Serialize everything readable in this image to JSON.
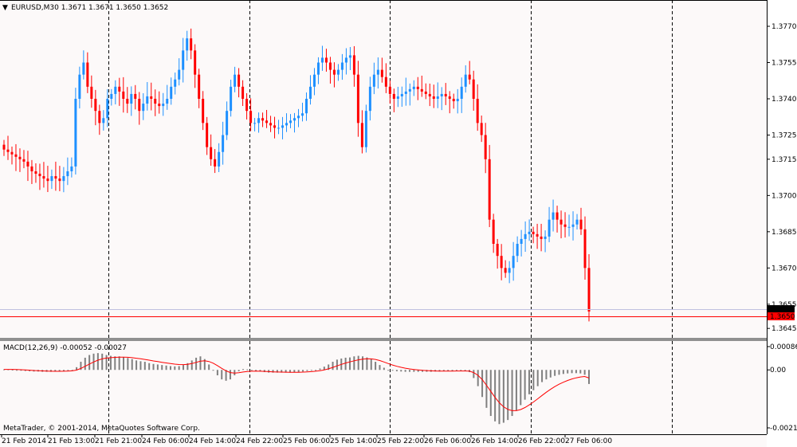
{
  "window": {
    "symbol_header": "EURUSD,M30  1.3671 1.3671 1.3650 1.3652",
    "header_arrow": "▼",
    "macd_header": "MACD(12,26,9) -0.00052 -0.00027",
    "copyright": "MetaTrader, © 2001-2014, MetaQuotes Software Corp.",
    "colors": {
      "background": "#fcf9f9",
      "bull": "#1e90ff",
      "bear": "#ff0000",
      "hist": "#808080",
      "signal": "#ff0000",
      "ask_line": "#c0c0e0",
      "bid_line": "#ff0000",
      "grid": "#000000"
    }
  },
  "price_axis": {
    "labels": [
      "1.3770",
      "1.3755",
      "1.3740",
      "1.3725",
      "1.3715",
      "1.3700",
      "1.3685",
      "1.3670",
      "1.3655",
      "1.3645"
    ],
    "current_ask": "1.3652",
    "current_bid": "1.3650"
  },
  "macd_axis": {
    "labels": [
      "0.00086",
      "0.00",
      "-0.00214"
    ]
  },
  "time_axis": {
    "labels": [
      "21 Feb 2014",
      "21 Feb 13:00",
      "21 Feb 21:00",
      "24 Feb 06:00",
      "24 Feb 14:00",
      "24 Feb 22:00",
      "25 Feb 06:00",
      "25 Feb 14:00",
      "25 Feb 22:00",
      "26 Feb 06:00",
      "26 Feb 14:00",
      "26 Feb 22:00",
      "27 Feb 06:00"
    ]
  },
  "chart_data": {
    "type": "line",
    "title": "EURUSD,M30",
    "price_series": [
      1.3719,
      1.3718,
      1.3717,
      1.3716,
      1.3715,
      1.3714,
      1.3712,
      1.371,
      1.3709,
      1.3708,
      1.3707,
      1.3706,
      1.3708,
      1.3707,
      1.3706,
      1.3708,
      1.371,
      1.3712,
      1.374,
      1.375,
      1.3755,
      1.3745,
      1.374,
      1.3735,
      1.373,
      1.3732,
      1.374,
      1.3742,
      1.3745,
      1.3743,
      1.374,
      1.3738,
      1.3742,
      1.374,
      1.3735,
      1.3738,
      1.3741,
      1.374,
      1.3738,
      1.3737,
      1.3738,
      1.374,
      1.3745,
      1.3748,
      1.3752,
      1.376,
      1.3765,
      1.376,
      1.375,
      1.374,
      1.373,
      1.372,
      1.3715,
      1.3712,
      1.3718,
      1.3725,
      1.3735,
      1.3745,
      1.375,
      1.3745,
      1.374,
      1.3735,
      1.373,
      1.373,
      1.3732,
      1.3731,
      1.373,
      1.3729,
      1.3728,
      1.3728,
      1.3729,
      1.373,
      1.3731,
      1.3732,
      1.3733,
      1.3734,
      1.374,
      1.3745,
      1.375,
      1.3755,
      1.3757,
      1.3755,
      1.3752,
      1.375,
      1.3752,
      1.3755,
      1.3757,
      1.3758,
      1.375,
      1.373,
      1.372,
      1.3735,
      1.3745,
      1.375,
      1.3752,
      1.3749,
      1.3745,
      1.3742,
      1.374,
      1.3741,
      1.3742,
      1.3743,
      1.3744,
      1.3745,
      1.3744,
      1.3743,
      1.3742,
      1.3741,
      1.374,
      1.3741,
      1.3742,
      1.3741,
      1.374,
      1.3739,
      1.374,
      1.3745,
      1.375,
      1.3748,
      1.374,
      1.373,
      1.3725,
      1.3715,
      1.369,
      1.368,
      1.3675,
      1.367,
      1.3668,
      1.367,
      1.3675,
      1.368,
      1.3682,
      1.3684,
      1.3685,
      1.3684,
      1.3683,
      1.3682,
      1.3683,
      1.369,
      1.3693,
      1.369,
      1.3688,
      1.3687,
      1.3687,
      1.3688,
      1.369,
      1.3686,
      1.367,
      1.3652
    ],
    "macd_hist": [
      2e-05,
      2e-05,
      1e-05,
      0.0,
      -2e-05,
      -4e-05,
      -5e-05,
      -6e-05,
      -6e-05,
      -7e-05,
      -7e-05,
      -7e-05,
      -6e-05,
      -5e-05,
      -4e-05,
      -2e-05,
      0.0,
      0.0001,
      0.0003,
      0.00045,
      0.00055,
      0.0006,
      0.00062,
      0.0006,
      0.00055,
      0.00052,
      0.0005,
      0.0005,
      0.00048,
      0.00044,
      0.0004,
      0.00035,
      0.00032,
      0.0003,
      0.00025,
      0.00022,
      0.0002,
      0.00018,
      0.00016,
      0.00014,
      0.00013,
      0.00014,
      0.00018,
      0.00025,
      0.00035,
      0.00045,
      0.0005,
      0.0004,
      0.0002,
      0.0,
      -0.0002,
      -0.00035,
      -0.0004,
      -0.00035,
      -0.0002,
      -5e-05,
      3e-05,
      2e-05,
      -1e-05,
      -4e-05,
      -6e-05,
      -8e-05,
      -0.0001,
      -0.0001,
      -0.0001,
      -0.0001,
      -0.0001,
      -0.0001,
      -9e-05,
      -8e-05,
      -6e-05,
      -4e-05,
      -2e-05,
      0.0,
      5e-05,
      0.00012,
      0.0002,
      0.0003,
      0.00038,
      0.00042,
      0.00045,
      0.00046,
      0.0005,
      0.00052,
      0.0005,
      0.00046,
      0.0004,
      0.0003,
      0.00018,
      8e-05,
      0.0,
      -3e-05,
      -5e-05,
      -6e-05,
      -7e-05,
      -7e-05,
      -7e-05,
      -7e-05,
      -7e-05,
      -7e-05,
      -7e-05,
      -6e-05,
      -6e-05,
      -5e-05,
      -4e-05,
      -4e-05,
      -3e-05,
      -3e-05,
      -4e-05,
      -8e-05,
      -0.0003,
      -0.0006,
      -0.001,
      -0.0014,
      -0.0017,
      -0.0019,
      -0.002,
      -0.00195,
      -0.00185,
      -0.0017,
      -0.0015,
      -0.0013,
      -0.0011,
      -0.0009,
      -0.00075,
      -0.0006,
      -0.00045,
      -0.00035,
      -0.00028,
      -0.00022,
      -0.00018,
      -0.00015,
      -0.00013,
      -0.00012,
      -0.00012,
      -0.00013,
      -0.00018,
      -0.00052
    ],
    "macd_range": [
      -0.00214,
      0.00086
    ],
    "price_range": [
      1.364,
      1.378
    ]
  }
}
